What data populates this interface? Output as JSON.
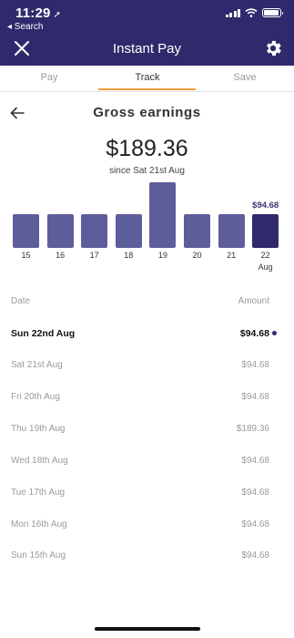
{
  "status_bar": {
    "time": "11:29",
    "back_label": "◂ Search"
  },
  "header": {
    "title": "Instant Pay",
    "close_icon": "close-icon",
    "settings_icon": "gear-icon"
  },
  "tabs": [
    {
      "label": "Pay",
      "active": false
    },
    {
      "label": "Track",
      "active": true
    },
    {
      "label": "Save",
      "active": false
    }
  ],
  "page": {
    "title": "Gross earnings",
    "total": "$189.36",
    "since": "since Sat 21st Aug"
  },
  "chart_data": {
    "type": "bar",
    "categories": [
      "15",
      "16",
      "17",
      "18",
      "19",
      "20",
      "21",
      "22"
    ],
    "values": [
      94.68,
      94.68,
      94.68,
      94.68,
      189.36,
      94.68,
      94.68,
      94.68
    ],
    "selected_index": 7,
    "selected_label": "$94.68",
    "selected_month": "Aug",
    "colors": {
      "bar": "#5d5d9b",
      "selected": "#2f2a6b"
    }
  },
  "list": {
    "date_header": "Date",
    "amount_header": "Amount",
    "rows": [
      {
        "date": "Sun 22nd Aug",
        "amount": "$94.68",
        "selected": true
      },
      {
        "date": "Sat 21st Aug",
        "amount": "$94.68"
      },
      {
        "date": "Fri 20th Aug",
        "amount": "$94.68"
      },
      {
        "date": "Thu 19th Aug",
        "amount": "$189.36"
      },
      {
        "date": "Wed 18th Aug",
        "amount": "$94.68"
      },
      {
        "date": "Tue 17th Aug",
        "amount": "$94.68"
      },
      {
        "date": "Mon 16th Aug",
        "amount": "$94.68"
      },
      {
        "date": "Sun 15th Aug",
        "amount": "$94.68"
      }
    ]
  },
  "colors": {
    "brand": "#2f2a6b",
    "accent": "#f39a3b"
  }
}
